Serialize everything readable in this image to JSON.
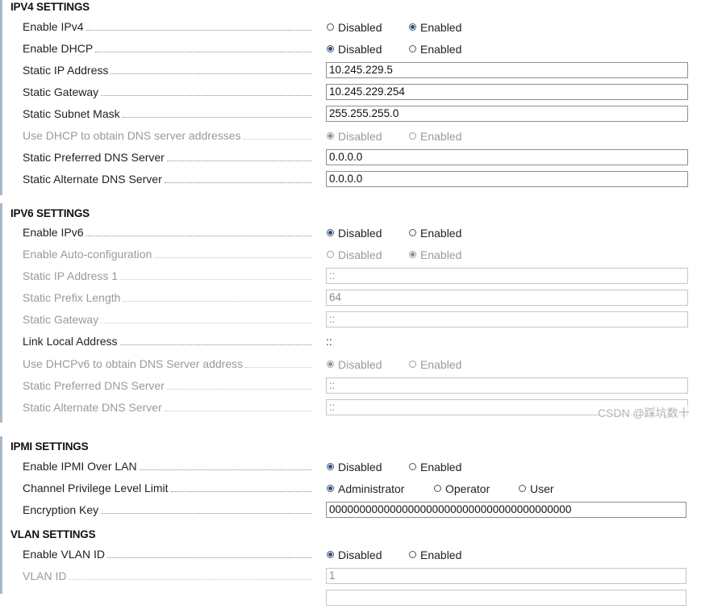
{
  "ipv4": {
    "title": "IPV4 SETTINGS",
    "enable_ipv4": {
      "label": "Enable IPv4",
      "opt1": "Disabled",
      "opt2": "Enabled",
      "selected": "Enabled"
    },
    "enable_dhcp": {
      "label": "Enable DHCP",
      "opt1": "Disabled",
      "opt2": "Enabled",
      "selected": "Disabled"
    },
    "static_ip": {
      "label": "Static IP Address",
      "value": "10.245.229.5"
    },
    "static_gateway": {
      "label": "Static Gateway",
      "value": "10.245.229.254"
    },
    "static_subnet": {
      "label": "Static Subnet Mask",
      "value": "255.255.255.0"
    },
    "dhcp_dns": {
      "label": "Use DHCP to obtain DNS server addresses",
      "opt1": "Disabled",
      "opt2": "Enabled",
      "selected": "Disabled"
    },
    "pref_dns": {
      "label": "Static Preferred DNS Server",
      "value": "0.0.0.0"
    },
    "alt_dns": {
      "label": "Static Alternate DNS Server",
      "value": "0.0.0.0"
    }
  },
  "ipv6": {
    "title": "IPV6 SETTINGS",
    "enable_ipv6": {
      "label": "Enable IPv6",
      "opt1": "Disabled",
      "opt2": "Enabled",
      "selected": "Disabled"
    },
    "auto_config": {
      "label": "Enable Auto-configuration",
      "opt1": "Disabled",
      "opt2": "Enabled",
      "selected": "Enabled"
    },
    "static_ip1": {
      "label": "Static IP Address 1",
      "value": "::"
    },
    "prefix_len": {
      "label": "Static Prefix Length",
      "value": "64"
    },
    "static_gateway": {
      "label": "Static Gateway",
      "value": "::"
    },
    "link_local": {
      "label": "Link Local Address",
      "value": "::"
    },
    "dhcpv6_dns": {
      "label": "Use DHCPv6 to obtain DNS Server address",
      "opt1": "Disabled",
      "opt2": "Enabled",
      "selected": "Disabled"
    },
    "pref_dns": {
      "label": "Static Preferred DNS Server",
      "value": "::"
    },
    "alt_dns": {
      "label": "Static Alternate DNS Server",
      "value": "::"
    }
  },
  "ipmi": {
    "title": "IPMI SETTINGS",
    "enable_lan": {
      "label": "Enable IPMI Over LAN",
      "opt1": "Disabled",
      "opt2": "Enabled",
      "selected": "Disabled"
    },
    "priv_level": {
      "label": "Channel Privilege Level Limit",
      "opt1": "Administrator",
      "opt2": "Operator",
      "opt3": "User",
      "selected": "Administrator"
    },
    "enc_key": {
      "label": "Encryption Key",
      "value": "0000000000000000000000000000000000000000"
    }
  },
  "vlan": {
    "title": "VLAN SETTINGS",
    "enable_vlan": {
      "label": "Enable VLAN ID",
      "opt1": "Disabled",
      "opt2": "Enabled",
      "selected": "Disabled"
    },
    "vlan_id": {
      "label": "VLAN ID",
      "value": "1"
    }
  },
  "watermark": "CSDN @踩坑数十"
}
